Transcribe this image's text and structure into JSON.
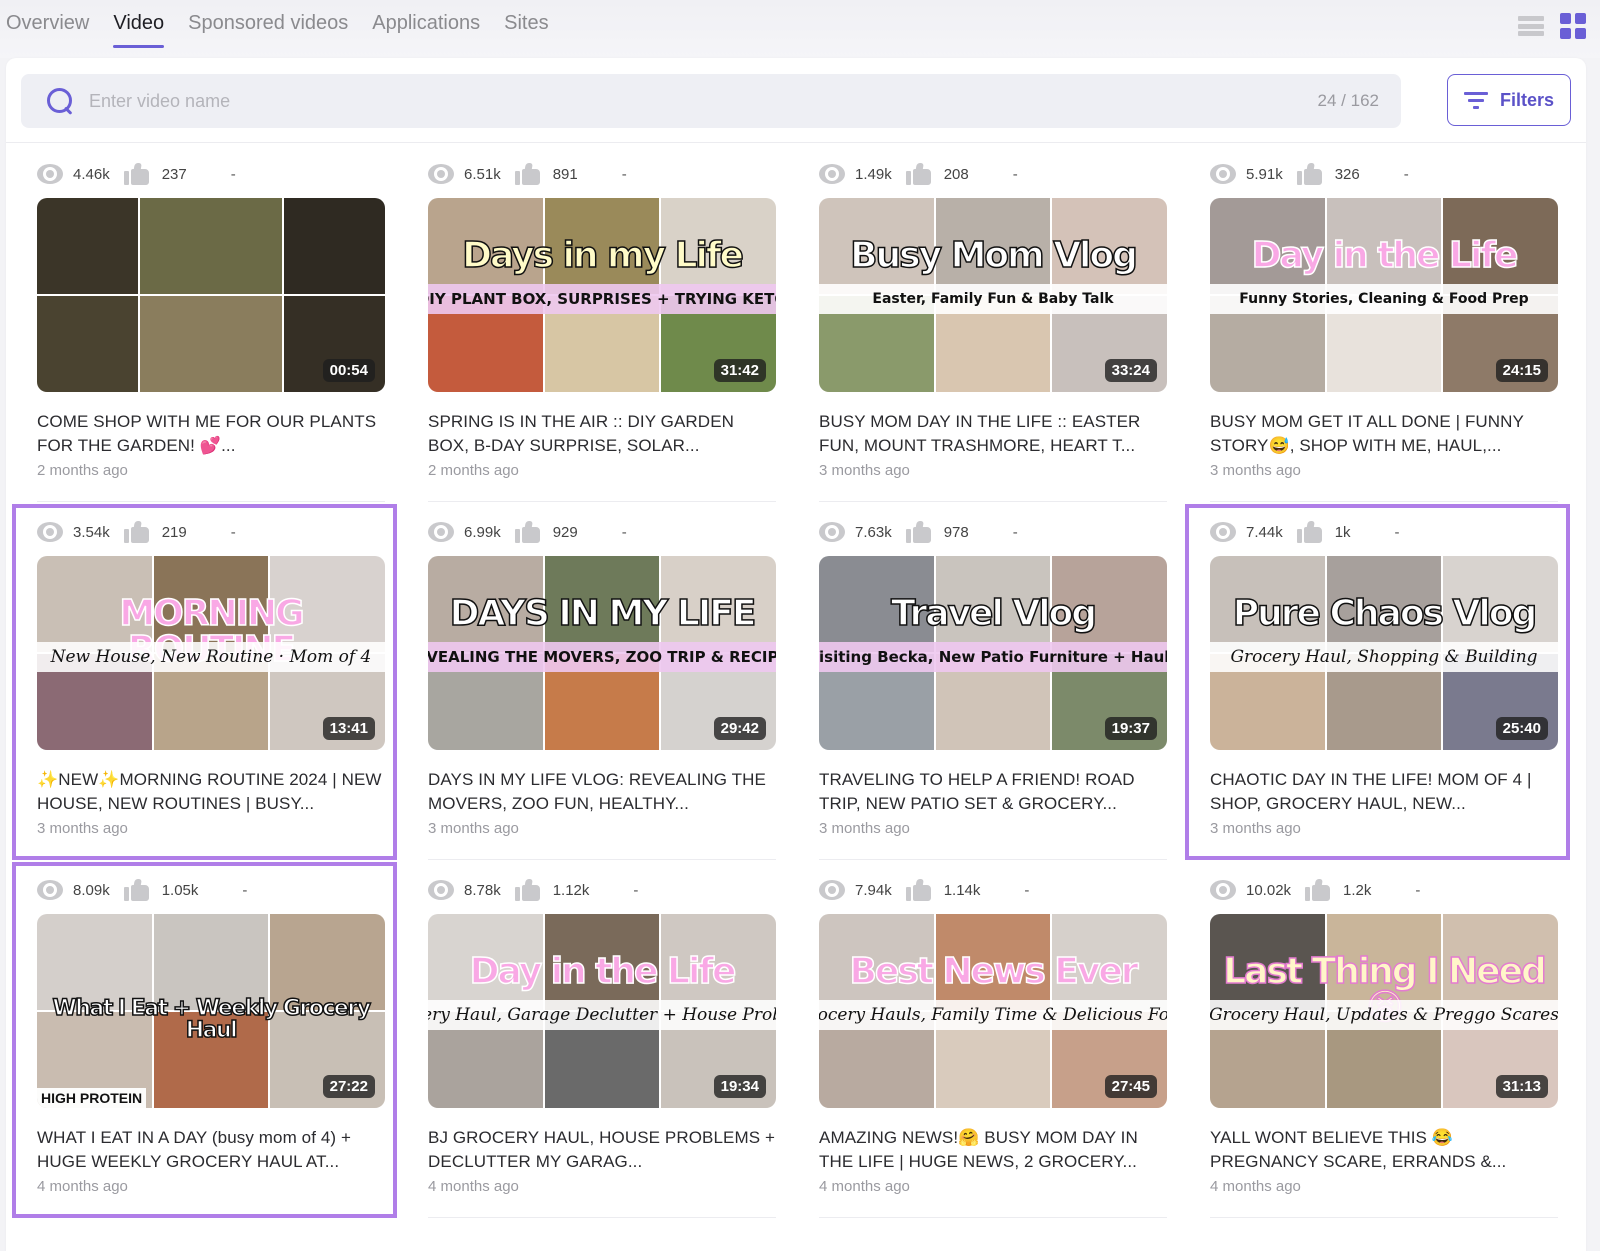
{
  "tabs": [
    {
      "label": "Overview",
      "active": false
    },
    {
      "label": "Video",
      "active": true
    },
    {
      "label": "Sponsored videos",
      "active": false
    },
    {
      "label": "Applications",
      "active": false
    },
    {
      "label": "Sites",
      "active": false
    }
  ],
  "view_toggle": {
    "list_icon": "list-view-icon",
    "grid_icon": "grid-view-icon",
    "active": "grid"
  },
  "search": {
    "placeholder": "Enter video name",
    "value": "",
    "count": "24 / 162",
    "icon": "search-icon"
  },
  "filters": {
    "label": "Filters",
    "icon": "filter-icon"
  },
  "colors": {
    "accent": "#6a5fd6",
    "highlight": "#b07ee8",
    "muted_icon": "#c9c9cc"
  },
  "videos": [
    {
      "views": "4.46k",
      "likes": "237",
      "extra": "-",
      "duration": "00:54",
      "title": "COME SHOP WITH ME FOR OUR PLANTS FOR THE GARDEN! 💕...",
      "age": "2 months ago",
      "highlighted": false,
      "thumb_title": "",
      "thumb_subtitle": ""
    },
    {
      "views": "6.51k",
      "likes": "891",
      "extra": "-",
      "duration": "31:42",
      "title": "SPRING IS IN THE AIR :: DIY GARDEN BOX, B-DAY SURPRISE, SOLAR...",
      "age": "2 months ago",
      "highlighted": false,
      "thumb_title": "Days in my Life",
      "thumb_subtitle": "DIY PLANT BOX, SURPRISES + TRYING KETO"
    },
    {
      "views": "1.49k",
      "likes": "208",
      "extra": "-",
      "duration": "33:24",
      "title": "BUSY MOM DAY IN THE LIFE :: EASTER FUN, MOUNT TRASHMORE, HEART T...",
      "age": "3 months ago",
      "highlighted": false,
      "thumb_title": "Busy Mom Vlog",
      "thumb_subtitle": "Easter, Family Fun & Baby Talk"
    },
    {
      "views": "5.91k",
      "likes": "326",
      "extra": "-",
      "duration": "24:15",
      "title": "BUSY MOM GET IT ALL DONE | FUNNY STORY😅, SHOP WITH ME, HAUL,...",
      "age": "3 months ago",
      "highlighted": false,
      "thumb_title": "Day in the Life",
      "thumb_subtitle": "Funny Stories, Cleaning & Food Prep"
    },
    {
      "views": "3.54k",
      "likes": "219",
      "extra": "-",
      "duration": "13:41",
      "title": "✨NEW✨MORNING ROUTINE 2024 | NEW HOUSE, NEW ROUTINES | BUSY...",
      "age": "3 months ago",
      "highlighted": true,
      "thumb_title": "MORNING ROUTINE",
      "thumb_subtitle": "New House, New Routine · Mom of 4"
    },
    {
      "views": "6.99k",
      "likes": "929",
      "extra": "-",
      "duration": "29:42",
      "title": "DAYS IN MY LIFE VLOG: REVEALING THE MOVERS, ZOO FUN, HEALTHY...",
      "age": "3 months ago",
      "highlighted": false,
      "thumb_title": "DAYS IN MY LIFE",
      "thumb_subtitle": "REVEALING THE MOVERS, ZOO TRIP & RECIPES"
    },
    {
      "views": "7.63k",
      "likes": "978",
      "extra": "-",
      "duration": "19:37",
      "title": "TRAVELING TO HELP A FRIEND! ROAD TRIP, NEW PATIO SET & GROCERY...",
      "age": "3 months ago",
      "highlighted": false,
      "thumb_title": "Travel Vlog",
      "thumb_subtitle": "Visiting Becka, New Patio Furniture + Hauls"
    },
    {
      "views": "7.44k",
      "likes": "1k",
      "extra": "-",
      "duration": "25:40",
      "title": "CHAOTIC DAY IN THE LIFE! MOM OF 4 | SHOP, GROCERY HAUL, NEW...",
      "age": "3 months ago",
      "highlighted": true,
      "thumb_title": "Pure Chaos Vlog",
      "thumb_subtitle": "Grocery Haul, Shopping & Building"
    },
    {
      "views": "8.09k",
      "likes": "1.05k",
      "extra": "-",
      "duration": "27:22",
      "title": "WHAT I EAT IN A DAY (busy mom of 4) + HUGE WEEKLY GROCERY HAUL AT...",
      "age": "4 months ago",
      "highlighted": true,
      "thumb_title": "What I Eat + Weekly Grocery Haul",
      "thumb_subtitle": "",
      "thumb_tag": "HIGH PROTEIN"
    },
    {
      "views": "8.78k",
      "likes": "1.12k",
      "extra": "-",
      "duration": "19:34",
      "title": "BJ GROCERY HAUL, HOUSE PROBLEMS + DECLUTTER MY GARAG...",
      "age": "4 months ago",
      "highlighted": false,
      "thumb_title": "Day in the Life",
      "thumb_subtitle": "Grocery Haul, Garage Declutter + House Problems"
    },
    {
      "views": "7.94k",
      "likes": "1.14k",
      "extra": "-",
      "duration": "27:45",
      "title": "AMAZING NEWS!🤗 BUSY MOM DAY IN THE LIFE | HUGE NEWS, 2 GROCERY...",
      "age": "4 months ago",
      "highlighted": false,
      "thumb_title": "Best News Ever",
      "thumb_subtitle": "Grocery Hauls, Family Time & Delicious Food"
    },
    {
      "views": "10.02k",
      "likes": "1.2k",
      "extra": "-",
      "duration": "31:13",
      "title": "YALL WONT BELIEVE THIS 😂 PREGNANCY SCARE, ERRANDS &...",
      "age": "4 months ago",
      "highlighted": false,
      "thumb_title": "Last Thing I Need 😫",
      "thumb_subtitle": "Grocery Haul, Updates & Preggo Scares"
    }
  ]
}
